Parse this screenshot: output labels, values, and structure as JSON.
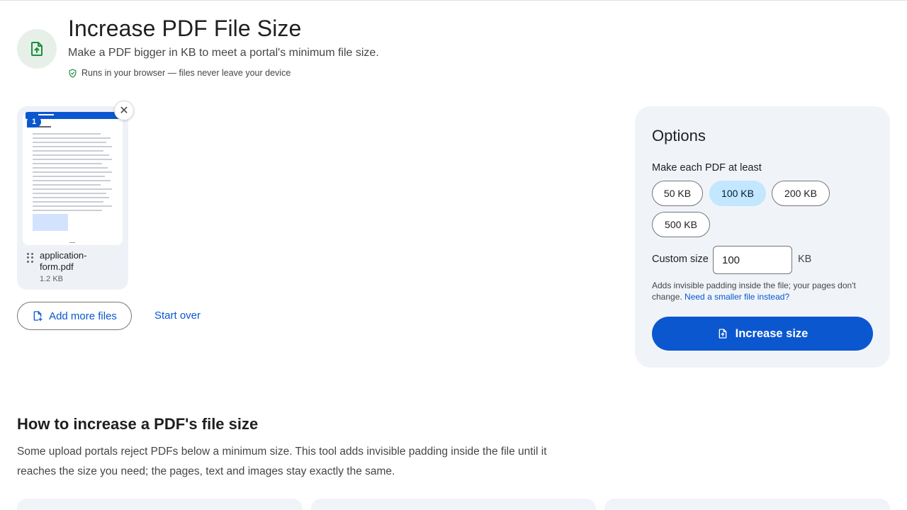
{
  "header": {
    "title": "Increase PDF File Size",
    "subtitle": "Make a PDF bigger in KB to meet a portal's minimum file size.",
    "privacy_note": "Runs in your browser — files never leave your device",
    "icon": "file-upload-icon",
    "accent_color": "#1e8e3e"
  },
  "file": {
    "name": "application-form.pdf",
    "size": "1.2 KB",
    "page_badge": "1",
    "remove_glyph": "✕"
  },
  "actions": {
    "add_more": "Add more files",
    "start_over": "Start over"
  },
  "options": {
    "title": "Options",
    "size_label": "Make each PDF at least",
    "presets": [
      {
        "label": "50 KB",
        "selected": false
      },
      {
        "label": "100 KB",
        "selected": true
      },
      {
        "label": "200 KB",
        "selected": false
      },
      {
        "label": "500 KB",
        "selected": false
      }
    ],
    "custom_label": "Custom size",
    "custom_value": "100",
    "custom_unit": "KB",
    "hint": "Adds invisible padding inside the file; your pages don't change.",
    "hint_link": "Need a smaller file instead?",
    "submit": "Increase size",
    "primary_color": "#0b57d0",
    "selected_chip_color": "#c2e7ff"
  },
  "howto": {
    "title": "How to increase a PDF's file size",
    "body": "Some upload portals reject PDFs below a minimum size. This tool adds invisible padding inside the file until it reaches the size you need; the pages, text and images stay exactly the same."
  }
}
